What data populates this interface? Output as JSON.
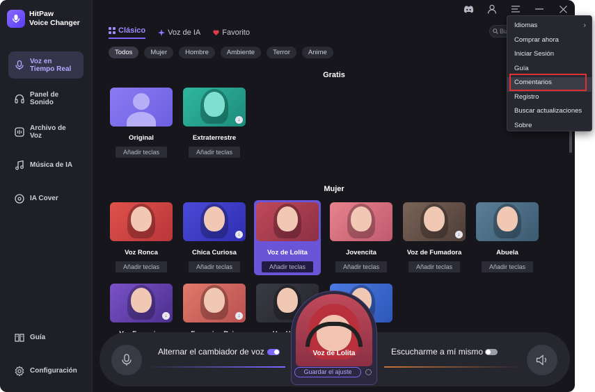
{
  "app": {
    "brand_name": "HitPaw\nVoice Changer"
  },
  "sidebar": {
    "items": [
      {
        "label": "Voz en Tiempo Real",
        "icon": "mic-icon",
        "active": true
      },
      {
        "label": "Panel de Sonido",
        "icon": "headphones-icon",
        "active": false
      },
      {
        "label": "Archivo de Voz",
        "icon": "audio-file-icon",
        "active": false
      },
      {
        "label": "Música de IA",
        "icon": "music-note-icon",
        "active": false
      },
      {
        "label": "IA Cover",
        "icon": "vinyl-icon",
        "active": false
      }
    ],
    "bottom_items": [
      {
        "label": "Guía",
        "icon": "book-icon"
      },
      {
        "label": "Configuración",
        "icon": "gear-icon"
      }
    ]
  },
  "tabs": [
    {
      "label": "Clásico",
      "icon": "grid-icon",
      "active": true
    },
    {
      "label": "Voz de IA",
      "icon": "sparkle-icon",
      "active": false
    },
    {
      "label": "Favorito",
      "icon": "heart-icon",
      "active": false
    }
  ],
  "search": {
    "placeholder": "Bu"
  },
  "filters": [
    "Todos",
    "Mujer",
    "Hombre",
    "Ambiente",
    "Terror",
    "Anime"
  ],
  "sections": {
    "free_title": "Gratis",
    "female_title": "Mujer"
  },
  "add_keys_label": "Añadir teclas",
  "free_voices": [
    {
      "name": "Original",
      "colors": [
        "#8b7cf2",
        "#6d5fe0"
      ]
    },
    {
      "name": "Extraterrestre",
      "colors": [
        "#2fb7a0",
        "#1d8b7a"
      ],
      "download": true
    }
  ],
  "female_voices": [
    {
      "name": "Voz Ronca",
      "colors": [
        "#e0524b",
        "#b8363a"
      ]
    },
    {
      "name": "Chica Curiosa",
      "colors": [
        "#4a4ad8",
        "#2e2eb0"
      ],
      "download": true
    },
    {
      "name": "Voz de Lolita",
      "colors": [
        "#c04a5a",
        "#8c2f44"
      ],
      "selected": true
    },
    {
      "name": "Jovencita",
      "colors": [
        "#e7838c",
        "#c05a70"
      ]
    },
    {
      "name": "Voz de Fumadora",
      "colors": [
        "#7a6458",
        "#4d3d36"
      ],
      "download": true
    },
    {
      "name": "Abuela",
      "colors": [
        "#5a7f97",
        "#3c5a70"
      ]
    }
  ],
  "row3_voices": [
    {
      "name": "Voz Femenina",
      "colors": [
        "#7a52c8",
        "#4b2f8c"
      ],
      "download": true
    },
    {
      "name": "Femenina Rein",
      "colors": [
        "#e07a6a",
        "#b85050"
      ],
      "download": true
    },
    {
      "name": "Voz Hada",
      "colors": [
        "#3a3a44",
        "#25252d"
      ]
    },
    {
      "name": "",
      "colors": [
        "#4a7ae0",
        "#2e56b8"
      ]
    }
  ],
  "bottom": {
    "toggle_voice_changer_label": "Alternar el cambiador de voz",
    "toggle_voice_changer_on": true,
    "hear_myself_label": "Escucharme a mí mismo",
    "hear_myself_on": false,
    "current_voice_name": "Voz de Lolita",
    "save_settings_label": "Guardar el ajuste"
  },
  "menu": {
    "items": [
      {
        "label": "Idiomas",
        "submenu": true
      },
      {
        "label": "Comprar ahora"
      },
      {
        "label": "Iniciar Sesión"
      },
      {
        "label": "Guía"
      },
      {
        "label": "Comentarios",
        "highlighted": true
      },
      {
        "label": "Registro"
      },
      {
        "label": "Buscar actualizaciones"
      },
      {
        "label": "Sobre"
      }
    ]
  },
  "colors": {
    "accent": "#7c68ff",
    "highlight_box": "#e03030"
  }
}
